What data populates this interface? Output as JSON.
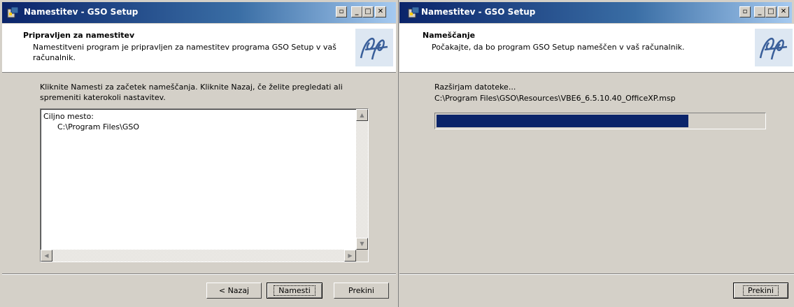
{
  "window1": {
    "title": "Namestitev - GSO Setup",
    "header_title": "Pripravljen za namestitev",
    "header_subtitle": "Namestitveni program je pripravljen za namestitev programa GSO Setup v vaš računalnik.",
    "instructions_line1": "Kliknite Namesti za začetek nameščanja. Kliknite Nazaj, če želite pregledati ali",
    "instructions_line2": "spremeniti katerokoli nastavitev.",
    "memo_label": "Ciljno mesto:",
    "memo_value": "C:\\Program Files\\GSO",
    "back_label": "< Nazaj",
    "install_label": "Namesti",
    "cancel_label": "Prekini"
  },
  "window2": {
    "title": "Namestitev - GSO Setup",
    "header_title": "Nameščanje",
    "header_subtitle": "Počakajte, da bo program GSO Setup nameščen v vaš računalnik.",
    "status_text": "Razširjam datoteke...",
    "file_path": "C:\\Program Files\\GSO\\Resources\\VBE6_6.5.10.40_OfficeXP.msp",
    "progress_fraction": 0.77,
    "cancel_label": "Prekini"
  },
  "colors": {
    "title_bar": "#0a246a",
    "progress": "#0a246a",
    "dialog_face": "#d4d0c8"
  },
  "icons": [
    "setup-app-icon",
    "restore-icon",
    "minimize-icon",
    "maximize-icon",
    "close-icon",
    "brand-logo"
  ]
}
